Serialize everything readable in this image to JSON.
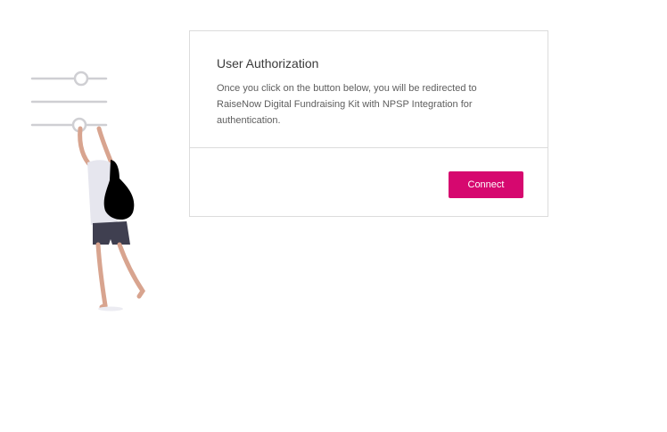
{
  "dialog": {
    "title": "User Authorization",
    "message": "Once you click on the button below, you will be redirected to RaiseNow Digital Fundraising Kit with NPSP Integration for authentication.",
    "connect_label": "Connect"
  },
  "illustration": {
    "icon": "settings-sliders-person-icon"
  },
  "colors": {
    "accent": "#d6086f",
    "border": "#dcdcdc",
    "title": "#3a3a3a",
    "text": "#5e5e5e",
    "illustration_gray": "#cfcfd3",
    "skin": "#d8a48f",
    "shorts": "#3f3f50"
  }
}
